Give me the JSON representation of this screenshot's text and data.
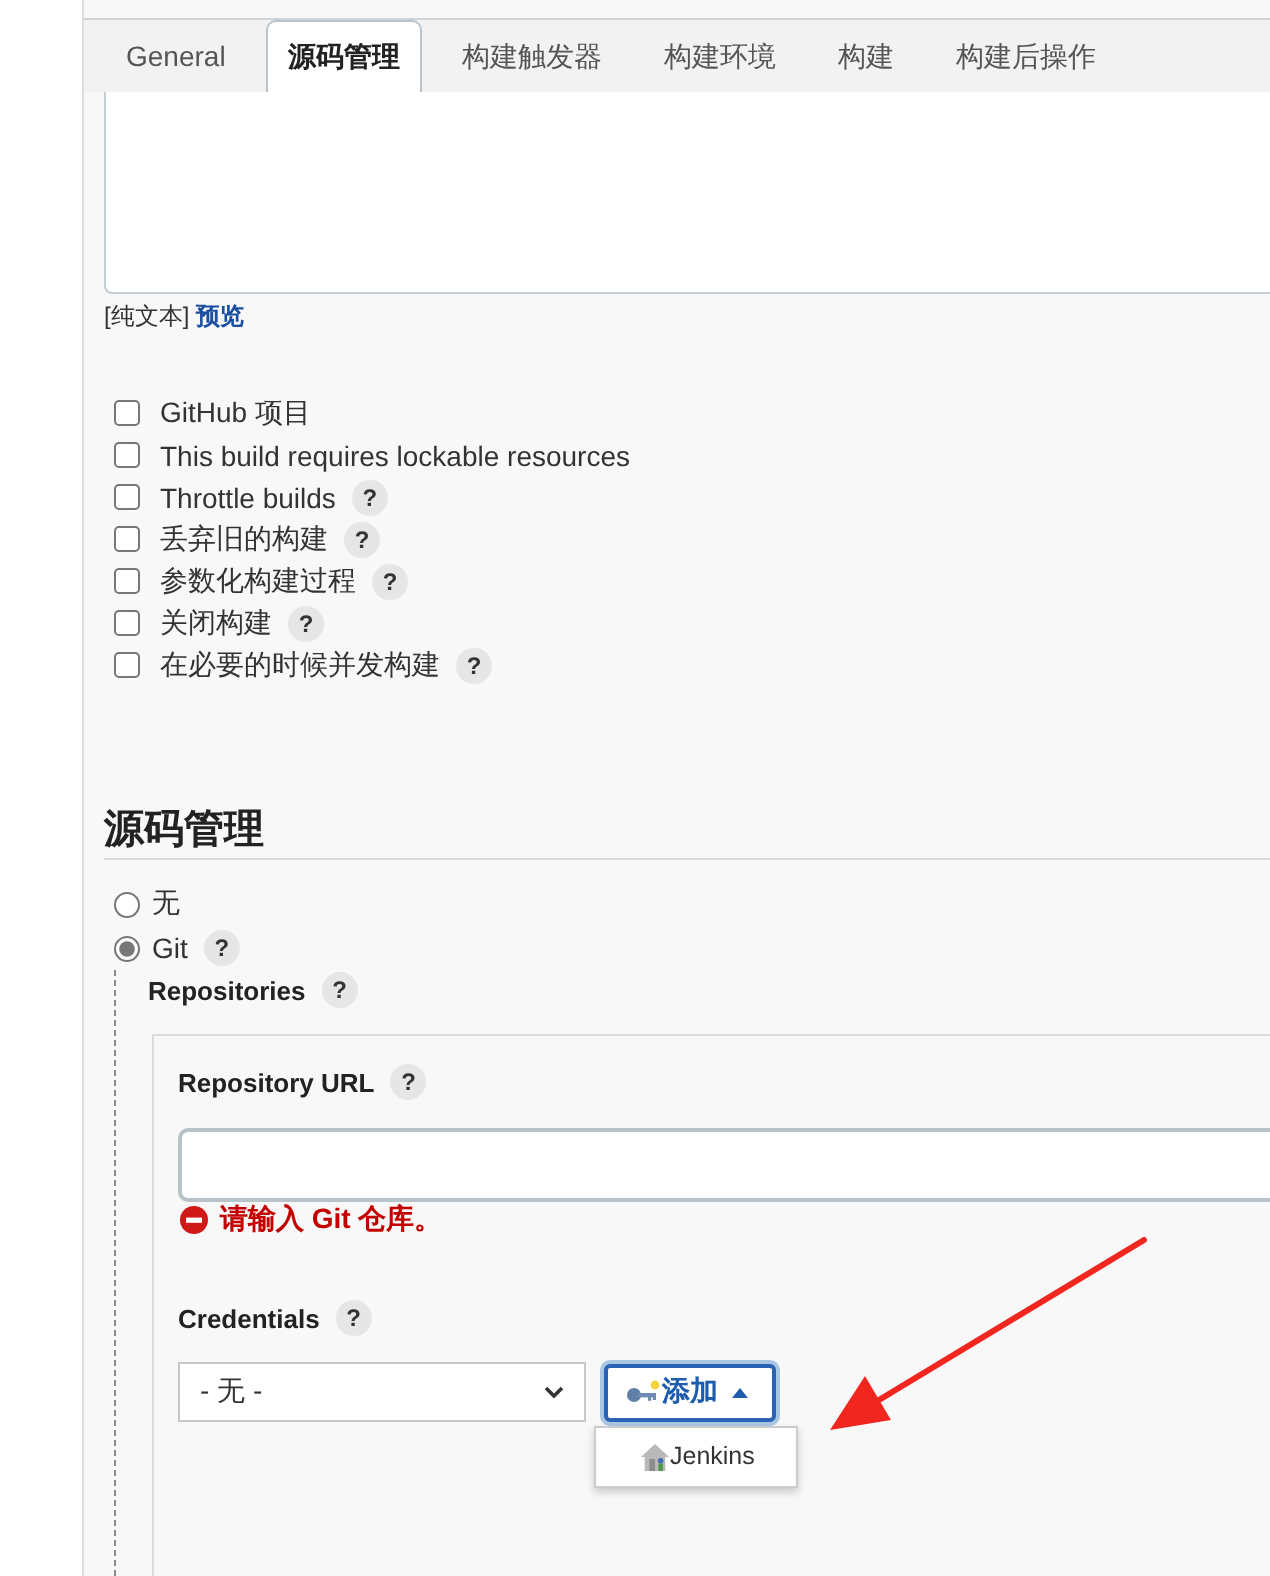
{
  "tabs": [
    {
      "label": "General",
      "selected": false
    },
    {
      "label": "源码管理",
      "selected": true
    },
    {
      "label": "构建触发器",
      "selected": false
    },
    {
      "label": "构建环境",
      "selected": false
    },
    {
      "label": "构建",
      "selected": false
    },
    {
      "label": "构建后操作",
      "selected": false
    }
  ],
  "description": {
    "format": "[纯文本]",
    "preview_link": "预览"
  },
  "options": [
    {
      "label": "GitHub 项目",
      "checked": false
    },
    {
      "label": "This build requires lockable resources",
      "checked": false
    },
    {
      "label": "Throttle builds",
      "checked": false,
      "help": "?"
    },
    {
      "label": "丢弃旧的构建",
      "checked": false,
      "help": "?"
    },
    {
      "label": "参数化构建过程",
      "checked": false,
      "help": "?"
    },
    {
      "label": "关闭构建",
      "checked": false,
      "help": "?"
    },
    {
      "label": "在必要的时候并发构建",
      "checked": false,
      "help": "?"
    }
  ],
  "scm": {
    "title": "源码管理",
    "choices": [
      {
        "label": "无",
        "selected": false
      },
      {
        "label": "Git",
        "selected": true,
        "help": "?"
      }
    ],
    "git": {
      "repositories_label": "Repositories",
      "repositories_help": "?",
      "repository_url": {
        "label": "Repository URL",
        "help": "?",
        "error": "请输入 Git 仓库。"
      },
      "credentials": {
        "label": "Credentials",
        "help": "?",
        "select_value": "- 无 -",
        "add_button": {
          "label": "添加",
          "expanded": true
        },
        "add_menu": [
          {
            "label": "Jenkins"
          }
        ]
      }
    }
  }
}
